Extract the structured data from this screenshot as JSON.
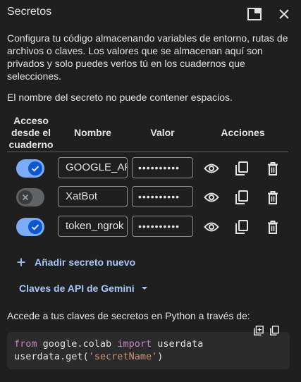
{
  "header": {
    "title": "Secretos"
  },
  "intro_text": "Configura tu código almacenando variables de entorno, rutas de archivos o claves. Los valores que se almacenan aquí son privados y solo puedes verlos tú en los cuadernos que selecciones.",
  "note_text": "El nombre del secreto no puede contener espacios.",
  "table": {
    "headers": {
      "access_line1": "Acceso",
      "access_line2": "desde el",
      "access_line3": "cuaderno",
      "name": "Nombre",
      "value": "Valor",
      "actions": "Acciones"
    },
    "rows": [
      {
        "name": "GOOGLE_API_KEY",
        "value": "••••••••••",
        "access": true
      },
      {
        "name": "XatBot",
        "value": "••••••••••",
        "access": false
      },
      {
        "name": "token_ngrok",
        "value": "••••••••••",
        "access": true
      }
    ]
  },
  "add_secret_label": "Añadir secreto nuevo",
  "gemini_label": "Claves de API de Gemini",
  "access_text": "Accede a tus claves de secretos en Python a través de:",
  "code": {
    "line1": {
      "kw1": "from",
      "mod": " google.colab ",
      "kw2": "import",
      "name": " userdata"
    },
    "line2": {
      "pre": "userdata.get(",
      "str": "'secretName'",
      "post": ")"
    }
  },
  "colors": {
    "background": "#1f1f1f",
    "accent": "#a8c7fa",
    "toggle_on": "#7cacf8",
    "toggle_off": "#5f6368"
  }
}
